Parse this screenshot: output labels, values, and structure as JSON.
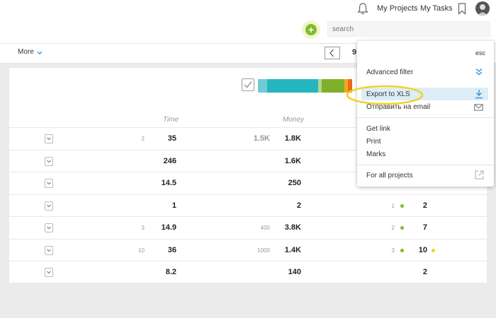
{
  "header": {
    "my_projects": "My Projects",
    "my_tasks": "My Tasks",
    "search_placeholder": "search",
    "add_label": "+",
    "more_label": "More",
    "page_number": "9"
  },
  "table": {
    "columns": [
      "Time",
      "Money"
    ],
    "rows": [
      {
        "time_small": "2",
        "time": "35",
        "money_small": "1.5K",
        "money": "1.8K",
        "count_small": "",
        "count": "",
        "extra": ""
      },
      {
        "time_small": "",
        "time": "246",
        "money_small": "",
        "money": "1.6K",
        "count_small": "",
        "count": "",
        "extra": ""
      },
      {
        "time_small": "",
        "time": "14.5",
        "money_small": "",
        "money": "250",
        "count_small": "",
        "count": "",
        "extra": ""
      },
      {
        "time_small": "",
        "time": "1",
        "money_small": "",
        "money": "2",
        "count_small": "1",
        "count": "2",
        "extra": ""
      },
      {
        "time_small": "3",
        "time": "14.9",
        "money_small": "400",
        "money": "3.8K",
        "count_small": "2",
        "count": "7",
        "extra": ""
      },
      {
        "time_small": "10",
        "time": "36",
        "money_small": "1000",
        "money": "1.4K",
        "count_small": "3",
        "count": "10",
        "extra": ""
      },
      {
        "time_small": "",
        "time": "8.2",
        "money_small": "",
        "money": "140",
        "count_small": "",
        "count": "2",
        "extra": ""
      }
    ]
  },
  "status_bar": {
    "colors": [
      "#6fcbd6",
      "#25b5bf",
      "#b7d48d",
      "#7fb02a",
      "#f5a623",
      "#e86c1a"
    ]
  },
  "popup": {
    "esc": "esc",
    "advanced_filter": "Advanced filter",
    "export_xls": "Export to XLS",
    "send_email": "Отправить на email",
    "get_link": "Get link",
    "print": "Print",
    "marks": "Marks",
    "for_all_projects": "For all projects"
  },
  "colors": {
    "accent_green": "#7fbb2c",
    "highlight_blue": "#dcedf8",
    "annotation_yellow": "#f3d21f",
    "link_blue": "#2a8bd6"
  }
}
